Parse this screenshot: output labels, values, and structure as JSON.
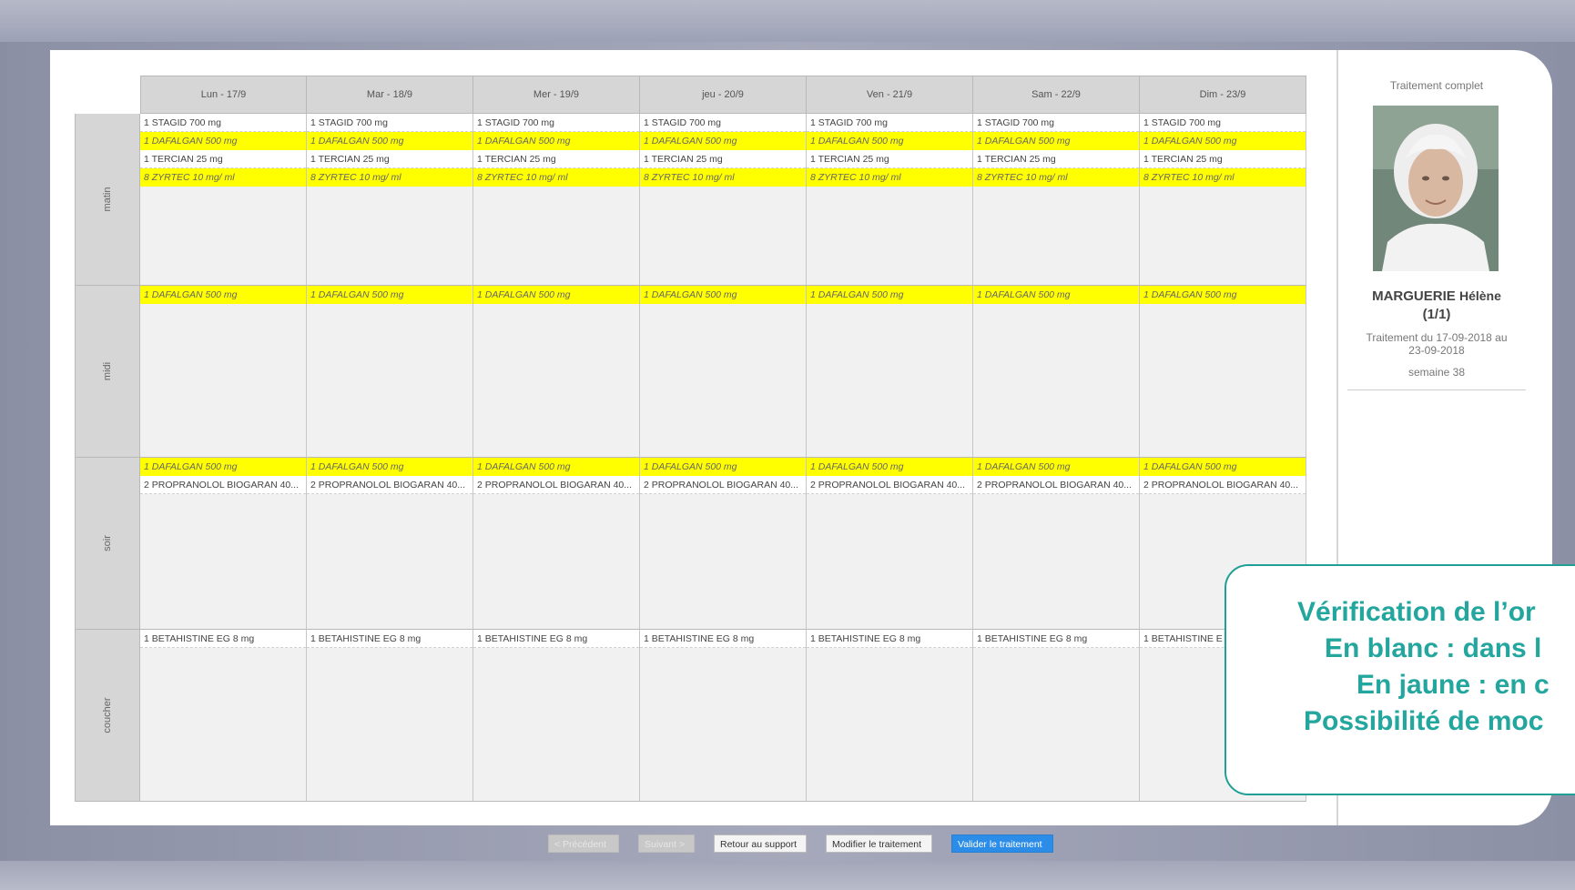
{
  "days": [
    "Lun - 17/9",
    "Mar - 18/9",
    "Mer - 19/9",
    "jeu - 20/9",
    "Ven - 21/9",
    "Sam - 22/9",
    "Dim - 23/9"
  ],
  "periods": [
    {
      "label": "matin",
      "meds": [
        {
          "text": "1 STAGID 700 mg",
          "color": "white"
        },
        {
          "text": "1 DAFALGAN 500 mg",
          "color": "yellow"
        },
        {
          "text": "1 TERCIAN 25 mg",
          "color": "white"
        },
        {
          "text": "8 ZYRTEC 10 mg/ ml",
          "color": "yellow"
        }
      ]
    },
    {
      "label": "midi",
      "meds": [
        {
          "text": "1 DAFALGAN 500 mg",
          "color": "yellow"
        }
      ]
    },
    {
      "label": "soir",
      "meds": [
        {
          "text": "1 DAFALGAN 500 mg",
          "color": "yellow"
        },
        {
          "text": "2 PROPRANOLOL BIOGARAN 40...",
          "color": "white"
        }
      ]
    },
    {
      "label": "coucher",
      "meds": [
        {
          "text": "1 BETAHISTINE EG 8 mg",
          "color": "white"
        }
      ]
    }
  ],
  "last_coucher_visible": "1 BETAHISTINE E",
  "sidebar": {
    "title": "Traitement complet",
    "last_name": "MARGUERIE",
    "first_name": "Hélène",
    "count": "(1/1)",
    "period_line1": "Traitement du 17-09-2018 au",
    "period_line2": "23-09-2018",
    "week": "semaine 38"
  },
  "buttons": {
    "previous": "< Précédent",
    "next": "Suivant >",
    "back": "Retour au support",
    "modify": "Modifier le traitement",
    "validate": "Valider le traitement"
  },
  "callout": {
    "line1": "Vérification de l’or",
    "line2": "En blanc : dans l",
    "line3": "En jaune : en c",
    "line4": "Possibilité de moc"
  },
  "colors": {
    "highlight": "#ffff00",
    "callout_text": "#22a69d",
    "primary_button": "#2c8de8"
  }
}
